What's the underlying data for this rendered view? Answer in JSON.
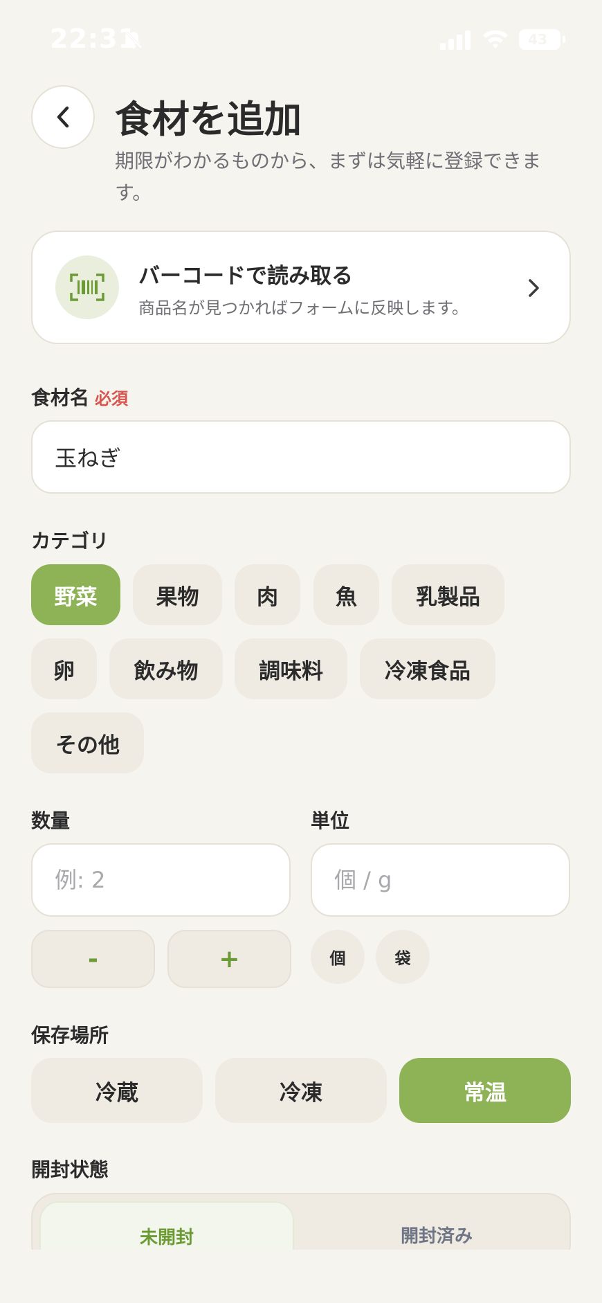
{
  "status_bar": {
    "time": "22:31",
    "battery": "43"
  },
  "header": {
    "title": "食材を追加",
    "subtitle": "期限がわかるものから、まずは気軽に登録できます。"
  },
  "barcode": {
    "title": "バーコードで読み取る",
    "description": "商品名が見つかればフォームに反映します。"
  },
  "name_field": {
    "label": "食材名",
    "required": "必須",
    "value": "玉ねぎ"
  },
  "category": {
    "label": "カテゴリ",
    "options": [
      "野菜",
      "果物",
      "肉",
      "魚",
      "乳製品",
      "卵",
      "飲み物",
      "調味料",
      "冷凍食品",
      "その他"
    ],
    "selected": "野菜"
  },
  "quantity": {
    "label": "数量",
    "placeholder": "例: 2",
    "minus": "-",
    "plus": "+"
  },
  "unit": {
    "label": "単位",
    "placeholder": "個 / g",
    "options": [
      "個",
      "袋"
    ]
  },
  "storage": {
    "label": "保存場所",
    "options": [
      "冷蔵",
      "冷凍",
      "常温"
    ],
    "selected": "常温"
  },
  "open_state": {
    "label": "開封状態",
    "options": [
      "未開封",
      "開封済み"
    ],
    "selected": "未開封"
  },
  "colors": {
    "accent": "#8db356",
    "accent_text": "#6c9b35",
    "required": "#d9534f",
    "background": "#f6f4ef"
  },
  "icons": [
    "bell-slash-icon",
    "signal-icon",
    "wifi-icon",
    "battery-icon",
    "chevron-left-icon",
    "barcode-icon",
    "chevron-right-icon"
  ]
}
